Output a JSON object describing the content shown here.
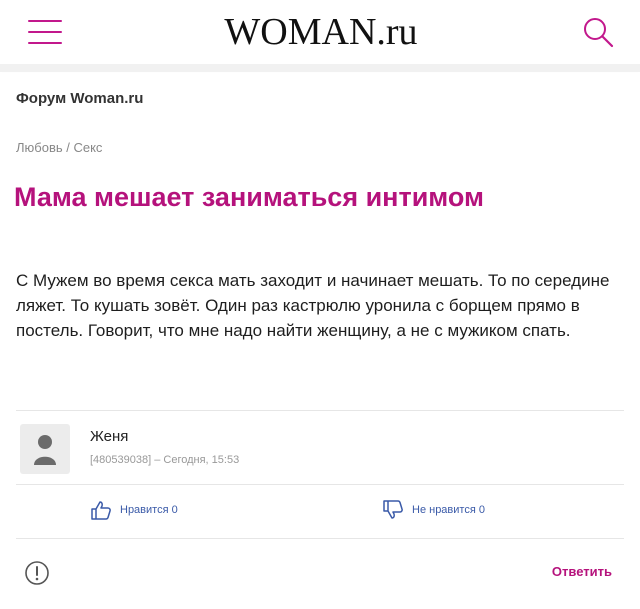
{
  "header": {
    "logo": "WOMAN.ru",
    "menu_icon": "hamburger-icon",
    "search_icon": "search-icon",
    "accent": "#c2188c"
  },
  "forum": {
    "title": "Форум Woman.ru",
    "breadcrumb": "Любовь / Секс"
  },
  "post": {
    "headline": "Мама мешает заниматься интимом",
    "text": "С Мужем во время секса мать заходит и начинает мешать. То по середине ляжет. То кушать зовёт. Один раз кастрюлю уронила с борщем прямо в постель. Говорит, что мне надо найти женщину, а не с мужиком спать.",
    "headline_color": "#b5127c"
  },
  "author": {
    "name": "Женя",
    "meta": "[480539038] – Сегодня, 15:53",
    "avatar_icon": "user-icon"
  },
  "actions": {
    "like_label": "Нравится 0",
    "dislike_label": "Не нравится 0",
    "like_icon": "thumbs-up-icon",
    "dislike_icon": "thumbs-down-icon",
    "report_icon": "exclamation-icon",
    "reply_label": "Ответить"
  }
}
